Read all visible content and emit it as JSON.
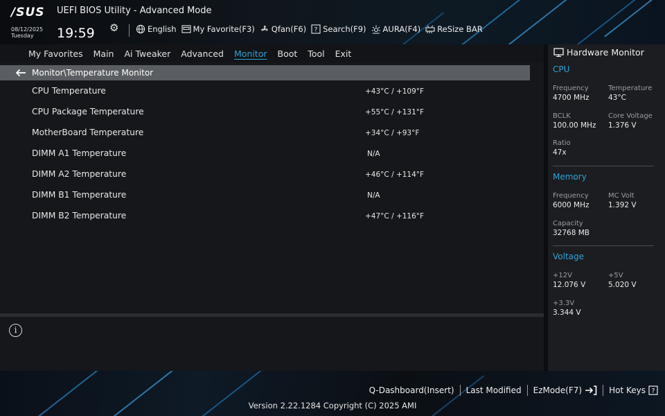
{
  "header": {
    "logo": "/SUS",
    "title": "UEFI BIOS Utility - Advanced Mode",
    "date": "08/12/2025",
    "day": "Tuesday",
    "time": "19:59",
    "tools": [
      {
        "label": "English",
        "icon": "globe-icon"
      },
      {
        "label": "My Favorite(F3)",
        "icon": "favorite-icon"
      },
      {
        "label": "Qfan(F6)",
        "icon": "fan-icon"
      },
      {
        "label": "Search(F9)",
        "icon": "search-icon"
      },
      {
        "label": "AURA(F4)",
        "icon": "aura-icon"
      },
      {
        "label": "ReSize BAR",
        "icon": "resize-bar-icon"
      }
    ]
  },
  "tabs": [
    {
      "label": "My Favorites"
    },
    {
      "label": "Main"
    },
    {
      "label": "Ai Tweaker"
    },
    {
      "label": "Advanced"
    },
    {
      "label": "Monitor",
      "active": true
    },
    {
      "label": "Boot"
    },
    {
      "label": "Tool"
    },
    {
      "label": "Exit"
    }
  ],
  "breadcrumb": "Monitor\\Temperature Monitor",
  "rows": [
    {
      "label": "CPU Temperature",
      "value": "+43°C / +109°F"
    },
    {
      "label": "CPU Package Temperature",
      "value": "+55°C / +131°F"
    },
    {
      "label": "MotherBoard Temperature",
      "value": "+34°C / +93°F"
    },
    {
      "label": "DIMM A1 Temperature",
      "value": "N/A"
    },
    {
      "label": "DIMM A2 Temperature",
      "value": "+46°C / +114°F"
    },
    {
      "label": "DIMM B1 Temperature",
      "value": "N/A"
    },
    {
      "label": "DIMM B2 Temperature",
      "value": "+47°C / +116°F"
    }
  ],
  "hw": {
    "title": "Hardware Monitor",
    "cpu": {
      "heading": "CPU",
      "frequency_label": "Frequency",
      "frequency": "4700 MHz",
      "temperature_label": "Temperature",
      "temperature": "43°C",
      "bclk_label": "BCLK",
      "bclk": "100.00 MHz",
      "core_voltage_label": "Core Voltage",
      "core_voltage": "1.376 V",
      "ratio_label": "Ratio",
      "ratio": "47x"
    },
    "memory": {
      "heading": "Memory",
      "frequency_label": "Frequency",
      "frequency": "6000 MHz",
      "mc_volt_label": "MC Volt",
      "mc_volt": "1.392 V",
      "capacity_label": "Capacity",
      "capacity": "32768 MB"
    },
    "voltage": {
      "heading": "Voltage",
      "v12_label": "+12V",
      "v12": "12.076 V",
      "v5_label": "+5V",
      "v5": "5.020 V",
      "v33_label": "+3.3V",
      "v33": "3.344 V"
    }
  },
  "footer": {
    "links": [
      {
        "label": "Q-Dashboard(Insert)"
      },
      {
        "label": "Last Modified"
      },
      {
        "label": "EzMode(F7)"
      },
      {
        "label": "Hot Keys"
      }
    ],
    "version": "Version 2.22.1284 Copyright (C) 2025 AMI"
  },
  "colors": {
    "accent": "#2aa5d8",
    "breadcrumb_bg": "#5a5d61",
    "panel_bg": "#15171a",
    "sidebar_bg": "#1b1d20"
  }
}
